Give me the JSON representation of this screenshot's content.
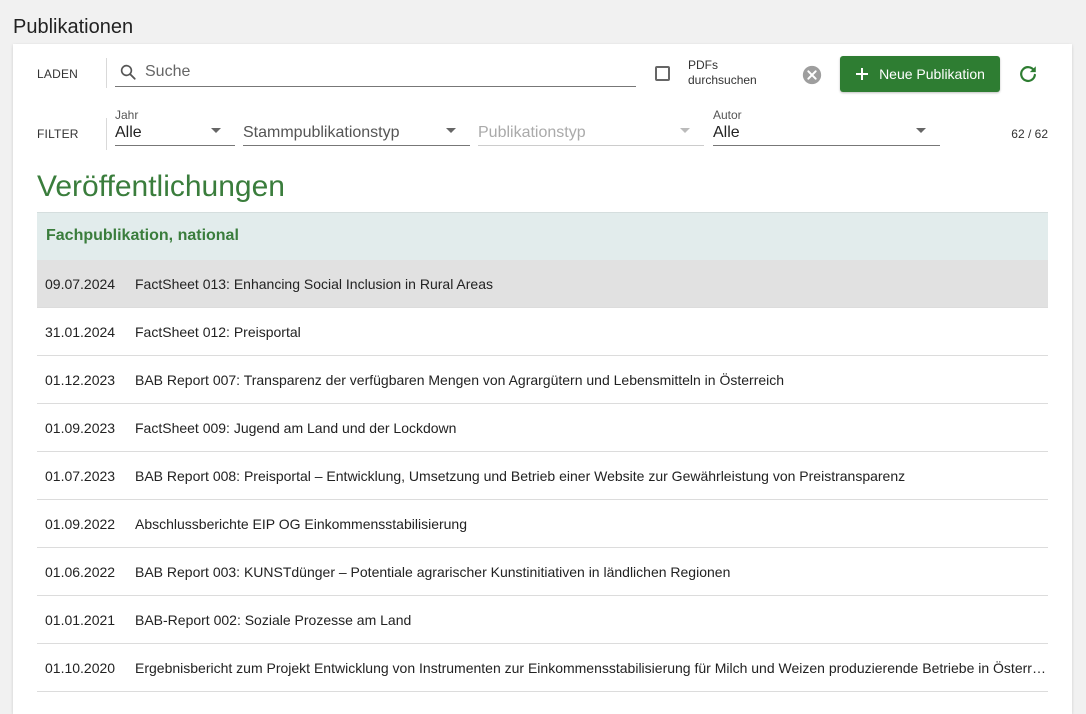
{
  "page": {
    "title": "Publikationen"
  },
  "toolbar": {
    "load_label": "LADEN",
    "search_placeholder": "Suche",
    "search_value": "",
    "pdf_checkbox_label": "PDFs durchsuchen",
    "pdf_checked": false,
    "new_button_label": "Neue Publikation",
    "icons": {
      "search": "search-icon",
      "clear": "clear-icon",
      "plus": "plus-icon",
      "refresh": "refresh-icon"
    }
  },
  "filter": {
    "label": "FILTER",
    "year": {
      "label": "Jahr",
      "value": "Alle"
    },
    "base_type": {
      "label": "",
      "value": "Stammpublikationstyp"
    },
    "type": {
      "label": "",
      "value": "Publikationstyp",
      "disabled": true
    },
    "author": {
      "label": "Autor",
      "value": "Alle"
    },
    "count": "62 / 62"
  },
  "main": {
    "heading": "Veröffentlichungen",
    "groups": [
      {
        "name": "Fachpublikation, national",
        "items": [
          {
            "date": "09.07.2024",
            "title": "FactSheet 013: Enhancing Social Inclusion in Rural Areas",
            "selected": true
          },
          {
            "date": "31.01.2024",
            "title": "FactSheet 012: Preisportal"
          },
          {
            "date": "01.12.2023",
            "title": "BAB Report 007: Transparenz der verfügbaren Mengen von Agrargütern und Lebensmitteln in Österreich"
          },
          {
            "date": "01.09.2023",
            "title": "FactSheet 009: Jugend am Land und der Lockdown"
          },
          {
            "date": "01.07.2023",
            "title": "BAB Report 008: Preisportal – Entwicklung, Umsetzung und Betrieb einer Website zur Gewährleistung von Preistransparenz"
          },
          {
            "date": "01.09.2022",
            "title": "Abschlussberichte EIP OG Einkommensstabilisierung"
          },
          {
            "date": "01.06.2022",
            "title": "BAB Report 003: KUNSTdünger – Potentiale agrarischer Kunstinitiativen in ländlichen Regionen"
          },
          {
            "date": "01.01.2021",
            "title": "BAB-Report 002: Soziale Prozesse am Land"
          },
          {
            "date": "01.10.2020",
            "title": "Ergebnisbericht zum Projekt Entwicklung von Instrumenten zur Einkommensstabilisierung für Milch und Weizen produzierende Betriebe in Österreich"
          }
        ]
      }
    ]
  },
  "colors": {
    "accent_green": "#2e7d32",
    "heading_green": "#3a7d3c",
    "group_header_bg": "#e2ecec",
    "selected_row_bg": "#e1e1e1",
    "page_bg": "#f1f1f1"
  }
}
